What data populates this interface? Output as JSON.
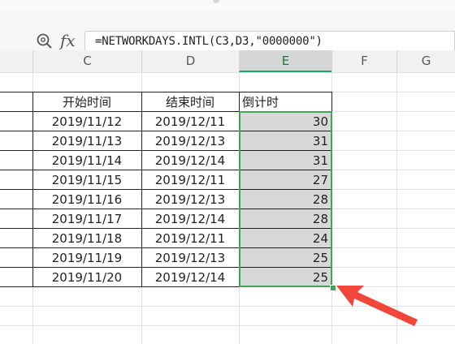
{
  "formula_bar": {
    "fx_label": "fx",
    "formula": "=NETWORKDAYS.INTL(C3,D3,\"0000000\")"
  },
  "columns": [
    "C",
    "D",
    "E",
    "F",
    "G"
  ],
  "selected_column": "E",
  "table": {
    "headers": [
      "开始时间",
      "结束时间",
      "倒计时"
    ],
    "rows": [
      {
        "start": "2019/11/12",
        "end": "2019/12/11",
        "countdown": "30"
      },
      {
        "start": "2019/11/13",
        "end": "2019/12/13",
        "countdown": "31"
      },
      {
        "start": "2019/11/14",
        "end": "2019/12/14",
        "countdown": "31"
      },
      {
        "start": "2019/11/15",
        "end": "2019/12/11",
        "countdown": "27"
      },
      {
        "start": "2019/11/16",
        "end": "2019/12/13",
        "countdown": "28"
      },
      {
        "start": "2019/11/17",
        "end": "2019/12/14",
        "countdown": "28"
      },
      {
        "start": "2019/11/18",
        "end": "2019/12/11",
        "countdown": "24"
      },
      {
        "start": "2019/11/19",
        "end": "2019/12/13",
        "countdown": "25"
      },
      {
        "start": "2019/11/20",
        "end": "2019/12/14",
        "countdown": "25"
      }
    ]
  },
  "colors": {
    "selection": "#3fa55a",
    "arrow": "#f0473a",
    "selected_fill": "#d8d8d8"
  }
}
